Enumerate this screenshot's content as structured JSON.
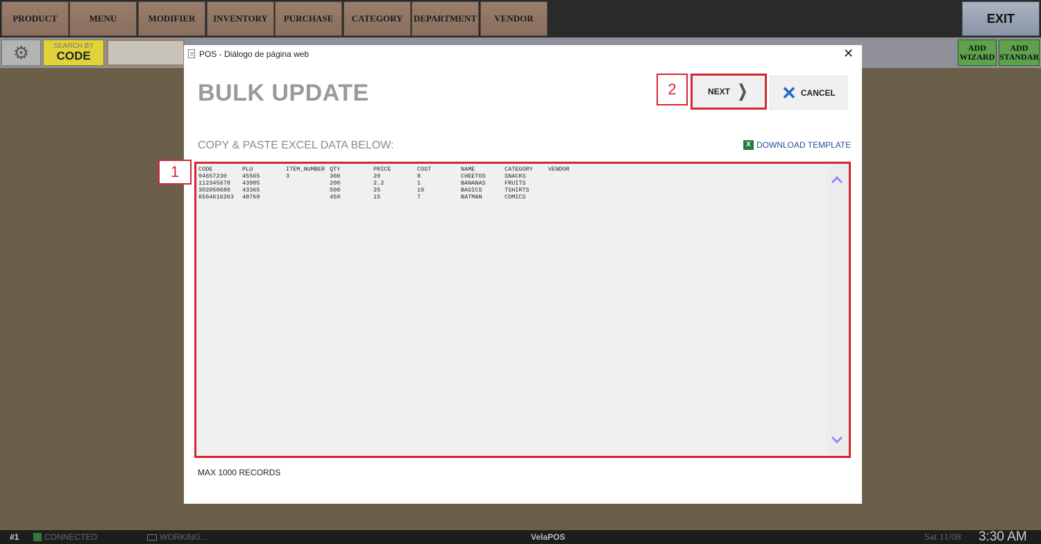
{
  "nav": {
    "items": [
      "PRODUCT",
      "MENU",
      "MODIFIER",
      "INVENTORY",
      "PURCHASE",
      "CATEGORY",
      "DEPARTMENT",
      "VENDOR"
    ],
    "exit_label": "EXIT"
  },
  "toolbar": {
    "search_by_small": "SEARCH BY",
    "search_by_big": "CODE",
    "add_wizard_line1": "ADD",
    "add_wizard_line2": "WIZARD",
    "add_standard_line1": "ADD",
    "add_standard_line2": "STANDAR"
  },
  "dialog": {
    "window_title": "POS - Diálogo de página web",
    "heading": "BULK UPDATE",
    "step2_marker": "2",
    "next_label": "NEXT",
    "cancel_label": "CANCEL",
    "copy_label": "COPY & PASTE EXCEL DATA BELOW:",
    "download_label": "DOWNLOAD TEMPLATE",
    "step1_marker": "1",
    "max_records": "MAX 1000 RECORDS"
  },
  "paste_data": {
    "headers": [
      "CODE",
      "PLU",
      "ITEM_NUMBER",
      "QTY",
      "PRICE",
      "COST",
      "NAME",
      "CATEGORY",
      "VENDOR"
    ],
    "rows": [
      [
        "94657230",
        "45565",
        "3",
        "300",
        "20",
        "8",
        "CHEETOS",
        "SNACKS",
        ""
      ],
      [
        "112345678",
        "43985",
        "",
        "200",
        "2.2",
        "1",
        "BANANAS",
        "FRUITS",
        ""
      ],
      [
        "302050680",
        "43365",
        "",
        "500",
        "25",
        "10",
        "BASICS",
        "TSHIRTS",
        ""
      ],
      [
        "6564616263",
        "48769",
        "",
        "450",
        "15",
        "7",
        "BATMAN",
        "COMICS",
        ""
      ]
    ]
  },
  "status": {
    "terminal": "#1",
    "connection": "CONNECTED",
    "working": "WORKING...",
    "app_name": "VelaPOS",
    "date": "Sat 11/08",
    "time": "3:30 AM"
  },
  "colors": {
    "highlight_red": "#d3262f",
    "background": "#6b5f4a",
    "nav_button": "#9a7e6c",
    "add_button_green": "#5fa24c",
    "search_yellow": "#e0d23a",
    "scroll_arrow": "#8a8cff"
  },
  "icons": [
    "gear-icon",
    "document-icon",
    "close-icon",
    "chevron-right-icon",
    "x-cancel-icon",
    "excel-icon",
    "chevron-up-icon",
    "chevron-down-icon"
  ]
}
